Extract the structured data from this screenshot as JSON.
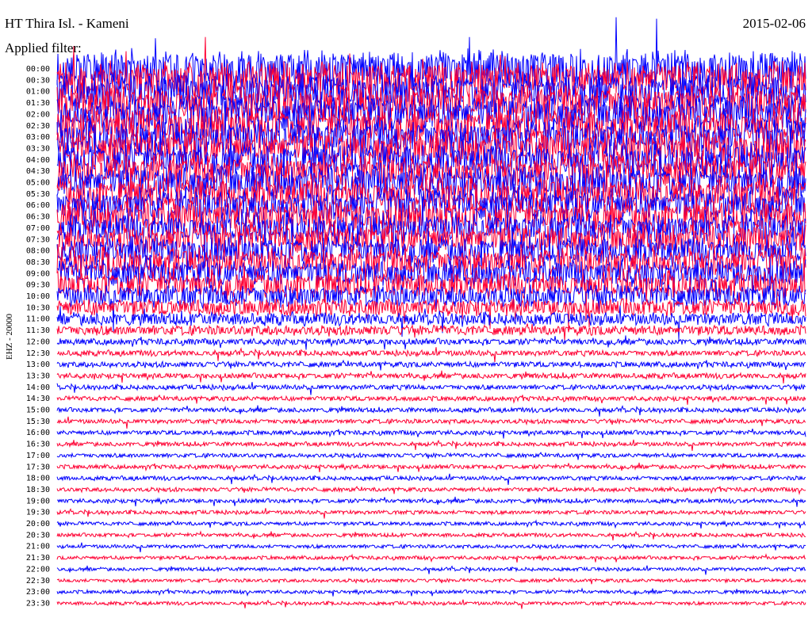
{
  "header": {
    "station": "HT Thira Isl. - Kameni",
    "date": "2015-02-06",
    "filter": "Applied filter:"
  },
  "chart_data": {
    "type": "helicorder",
    "ylabel": "EHZ - 20000",
    "tick_labels": [
      "00:00",
      "00:30",
      "01:00",
      "01:30",
      "02:00",
      "02:30",
      "03:00",
      "03:30",
      "04:00",
      "04:30",
      "05:00",
      "05:30",
      "06:00",
      "06:30",
      "07:00",
      "07:30",
      "08:00",
      "08:30",
      "09:00",
      "09:30",
      "10:00",
      "10:30",
      "11:00",
      "11:30",
      "12:00",
      "12:30",
      "13:00",
      "13:30",
      "14:00",
      "14:30",
      "15:00",
      "15:30",
      "16:00",
      "16:30",
      "17:00",
      "17:30",
      "18:00",
      "18:30",
      "19:00",
      "19:30",
      "20:00",
      "20:30",
      "21:00",
      "21:30",
      "22:00",
      "22:30",
      "23:00",
      "23:30"
    ],
    "trace_colors": [
      "#0000ff",
      "#ff0033"
    ],
    "relative_amplitude": [
      2.6,
      2.6,
      2.5,
      2.5,
      2.5,
      2.4,
      2.4,
      2.4,
      2.3,
      2.3,
      2.3,
      2.2,
      2.2,
      2.2,
      2.1,
      2.1,
      2.0,
      2.0,
      1.9,
      1.8,
      1.6,
      1.2,
      0.9,
      0.7,
      0.45,
      0.4,
      0.4,
      0.38,
      0.35,
      0.34,
      0.33,
      0.32,
      0.32,
      0.3,
      0.3,
      0.3,
      0.3,
      0.3,
      0.3,
      0.28,
      0.27,
      0.27,
      0.26,
      0.26,
      0.25,
      0.25,
      0.25,
      0.25
    ]
  }
}
